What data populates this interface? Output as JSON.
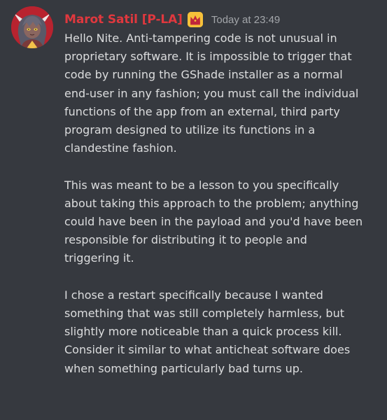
{
  "message": {
    "author": {
      "name": "Marot Satil [P-LA]",
      "name_color": "#e0383e",
      "avatar": "avatar",
      "badge": "crown-icon",
      "badge_color": "#f6c13a"
    },
    "timestamp": "Today at 23:49",
    "paragraphs": [
      {
        "lines": [
          "Hello Nite. Anti-tampering code is not unusual in",
          "proprietary software. It is impossible to trigger that",
          "code by running the GShade installer as a normal",
          "end-user in any fashion; you must call the individual",
          "functions of the app from an external, third party",
          "program designed to utilize its functions in a",
          "clandestine fashion."
        ]
      },
      {
        "lines": [
          "This was meant to be a lesson to you specifically",
          "about taking this approach to the problem; anything",
          "could have been in the payload and you'd have been",
          "responsible for distributing it to people and",
          "triggering it."
        ]
      },
      {
        "lines": [
          "I chose a restart specifically because I wanted",
          "something that was still completely harmless, but",
          "slightly more noticeable than a quick process kill.",
          "Consider it similar to what anticheat software does",
          "when something particularly bad turns up."
        ]
      }
    ]
  },
  "theme": {
    "background": "#36393f",
    "text": "#dcddde",
    "muted": "#a3a6aa"
  }
}
